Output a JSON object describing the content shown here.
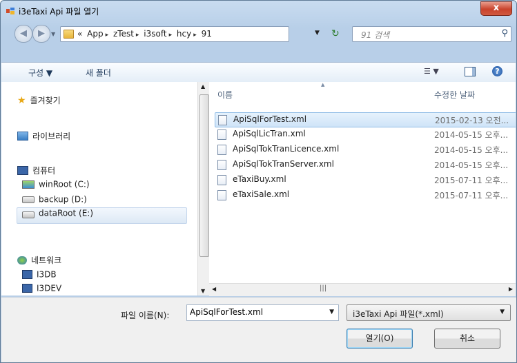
{
  "window": {
    "title": "i3eTaxi Api 파일 열기",
    "close_label": "x"
  },
  "address": {
    "breadcrumb": [
      "«",
      "App",
      "zTest",
      "i3soft",
      "hcy",
      "91"
    ],
    "separator": "▸",
    "search_placeholder": "91 검색"
  },
  "toolbar": {
    "organize": "구성 ▼",
    "new_folder": "새 폴더",
    "view_drop": "▼",
    "help": "?"
  },
  "nav": {
    "favorites": "즐겨찾기",
    "libraries": "라이브러리",
    "computer": "컴퓨터",
    "drives": [
      "winRoot (C:)",
      "backup (D:)",
      "dataRoot (E:)"
    ],
    "network": "네트워크",
    "network_items": [
      "I3DB",
      "I3DEV"
    ]
  },
  "columns": {
    "name": "이름",
    "modified": "수정한 날짜"
  },
  "files": [
    {
      "name": "ApiSqlForTest.xml",
      "date": "2015-02-13 오전..."
    },
    {
      "name": "ApiSqlLicTran.xml",
      "date": "2014-05-15 오후..."
    },
    {
      "name": "ApiSqlTokTranLicence.xml",
      "date": "2014-05-15 오후..."
    },
    {
      "name": "ApiSqlTokTranServer.xml",
      "date": "2014-05-15 오후..."
    },
    {
      "name": "eTaxiBuy.xml",
      "date": "2015-07-11 오후..."
    },
    {
      "name": "eTaxiSale.xml",
      "date": "2015-07-11 오후..."
    }
  ],
  "bottom": {
    "filename_label": "파일 이름(N):",
    "filename_value": "ApiSqlForTest.xml",
    "filter_value": "i3eTaxi Api 파일(*.xml)",
    "open_label": "열기(O)",
    "cancel_label": "취소"
  },
  "colors": {
    "selection": "#cce8ff",
    "titlebar": "#c9dcf0"
  }
}
